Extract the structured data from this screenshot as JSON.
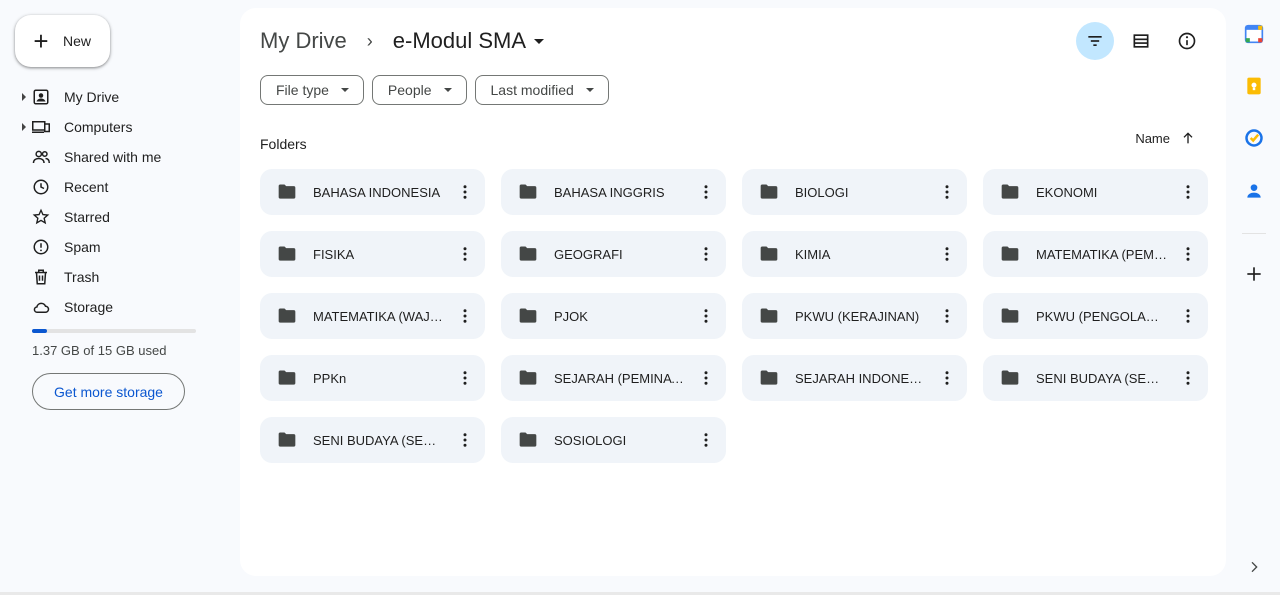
{
  "sidebar": {
    "new_label": "New",
    "items": [
      {
        "label": "My Drive",
        "icon": "my-drive-icon",
        "expandable": true
      },
      {
        "label": "Computers",
        "icon": "computers-icon",
        "expandable": true
      },
      {
        "label": "Shared with me",
        "icon": "shared-icon",
        "expandable": false
      },
      {
        "label": "Recent",
        "icon": "clock-icon",
        "expandable": false
      },
      {
        "label": "Starred",
        "icon": "star-icon",
        "expandable": false
      },
      {
        "label": "Spam",
        "icon": "spam-icon",
        "expandable": false
      },
      {
        "label": "Trash",
        "icon": "trash-icon",
        "expandable": false
      },
      {
        "label": "Storage",
        "icon": "cloud-icon",
        "expandable": false
      }
    ],
    "storage_used_fraction": 0.091,
    "storage_text": "1.37 GB of 15 GB used",
    "get_storage_label": "Get more storage"
  },
  "header": {
    "root": "My Drive",
    "separator": "›",
    "current": "e-Modul SMA"
  },
  "filters": [
    {
      "label": "File type"
    },
    {
      "label": "People"
    },
    {
      "label": "Last modified"
    }
  ],
  "section": {
    "folders_label": "Folders",
    "sort_label": "Name"
  },
  "folders": [
    "BAHASA INDONESIA",
    "BAHASA INGGRIS",
    "BIOLOGI",
    "EKONOMI",
    "FISIKA",
    "GEOGRAFI",
    "KIMIA",
    "MATEMATIKA (PEMINATAN)",
    "MATEMATIKA (WAJIB)",
    "PJOK",
    "PKWU (KERAJINAN)",
    "PKWU (PENGOLAHAN)",
    "PPKn",
    "SEJARAH (PEMINATAN)",
    "SEJARAH INDONESIA",
    "SENI BUDAYA (SENI RUPA)",
    "SENI BUDAYA (SENI MUSIK)",
    "SOSIOLOGI"
  ],
  "colors": {
    "accent": "#0b57d0",
    "active_bg": "#c2e7ff",
    "folder_bg": "#f0f4f9",
    "folder_icon": "#444746"
  }
}
